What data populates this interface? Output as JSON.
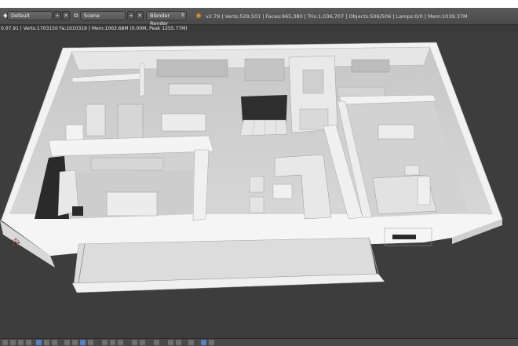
{
  "header": {
    "screen_layout": "Default",
    "scene": "Scene",
    "render_engine": "Blender Render",
    "stats": "v2.79 | Verts:529,501 | Faces:965,380 | Tris:1,036,707 | Objects:506/506 | Lamps:0/0 | Mem:1039.37M"
  },
  "info": {
    "text": "0.07.91 | Verts:1703150 Fa:1010319 | Mem:1063.68M (0.00M, Peak 1255.77M)"
  },
  "icons": {
    "editor_type": "blender-icon",
    "layout_menu": "layout-icon",
    "scene_menu": "scene-icon",
    "render_menu": "render-icon",
    "blender_logo": "blender-logo-icon"
  },
  "colors": {
    "viewport_bg": "#3d3d3d",
    "header_bg": "#505050",
    "model_white": "#ececec",
    "model_floor": "#cfcfcf"
  }
}
